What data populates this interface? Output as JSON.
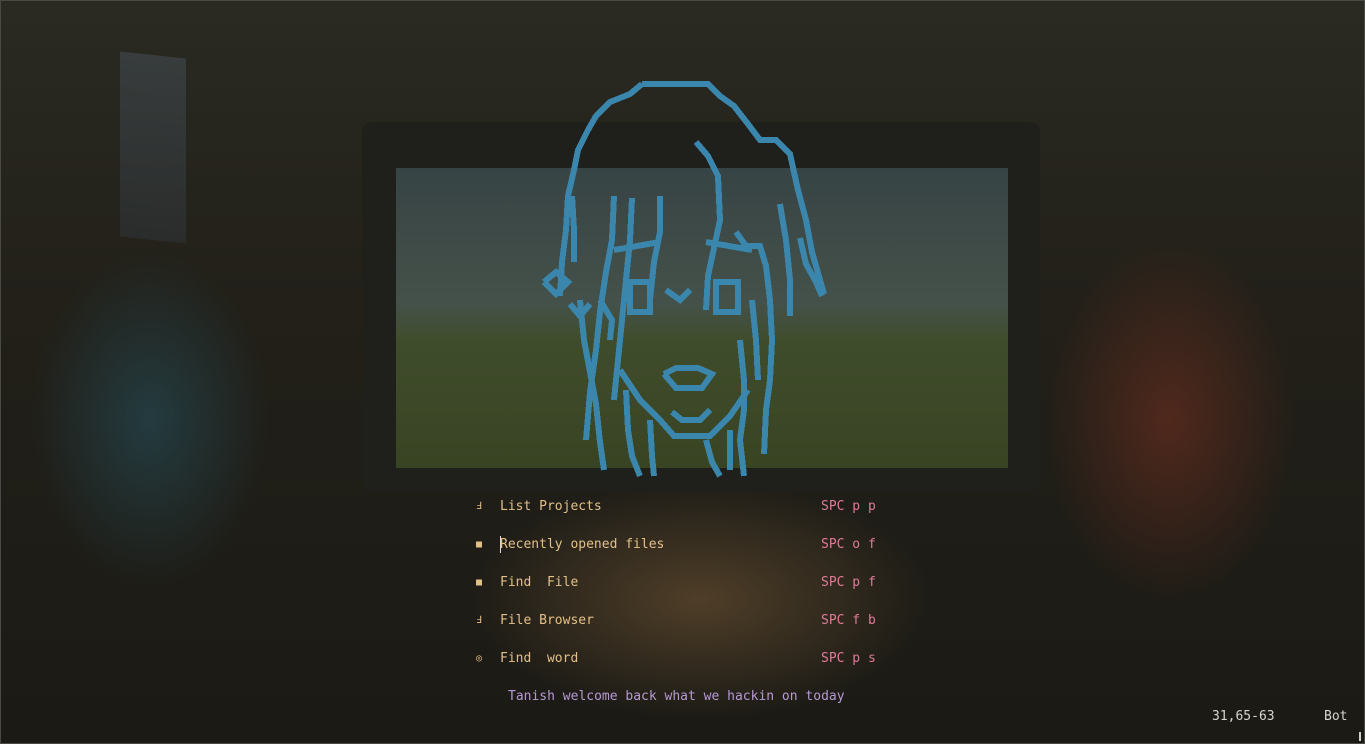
{
  "colors": {
    "ascii_art": "#3a86ad",
    "menu_label": "#e3c08a",
    "menu_shortcut": "#e07a9a",
    "footer": "#b79ad4",
    "statusline": "#d6d6d0"
  },
  "menu": [
    {
      "icon": "folder-icon",
      "glyph": "Ⅎ",
      "label": "List Projects",
      "shortcut": "SPC p p"
    },
    {
      "icon": "files-icon",
      "glyph": "■",
      "label": "Recently opened files",
      "shortcut": "SPC o f"
    },
    {
      "icon": "file-icon",
      "glyph": "■",
      "label": "Find  File",
      "shortcut": "SPC p f"
    },
    {
      "icon": "folder-icon",
      "glyph": "Ⅎ",
      "label": "File Browser",
      "shortcut": "SPC f b"
    },
    {
      "icon": "word-search-icon",
      "glyph": "◎",
      "label": "Find  word",
      "shortcut": "SPC p s"
    }
  ],
  "footer": "Tanish welcome back what we hackin on today",
  "statusline": {
    "position": "31,65-63",
    "scroll": "Bot"
  }
}
